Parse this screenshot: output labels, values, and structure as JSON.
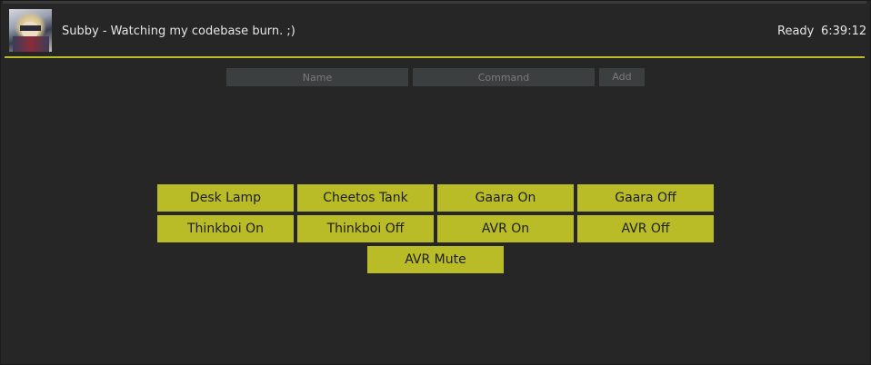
{
  "header": {
    "status_message": "Subby - Watching my codebase burn. ;)",
    "state_label": "Ready",
    "clock": "6:39:12",
    "avatar_icon": "avatar-icon"
  },
  "form": {
    "name_placeholder": "Name",
    "command_placeholder": "Command",
    "add_label": "Add"
  },
  "buttons": [
    {
      "label": "Desk Lamp"
    },
    {
      "label": "Cheetos Tank"
    },
    {
      "label": "Gaara On"
    },
    {
      "label": "Gaara Off"
    },
    {
      "label": "Thinkboi On"
    },
    {
      "label": "Thinkboi Off"
    },
    {
      "label": "AVR On"
    },
    {
      "label": "AVR Off"
    },
    {
      "label": "AVR Mute"
    }
  ],
  "colors": {
    "accent": "#b9bb27",
    "background": "#262626",
    "input_background": "#3c3f40"
  }
}
